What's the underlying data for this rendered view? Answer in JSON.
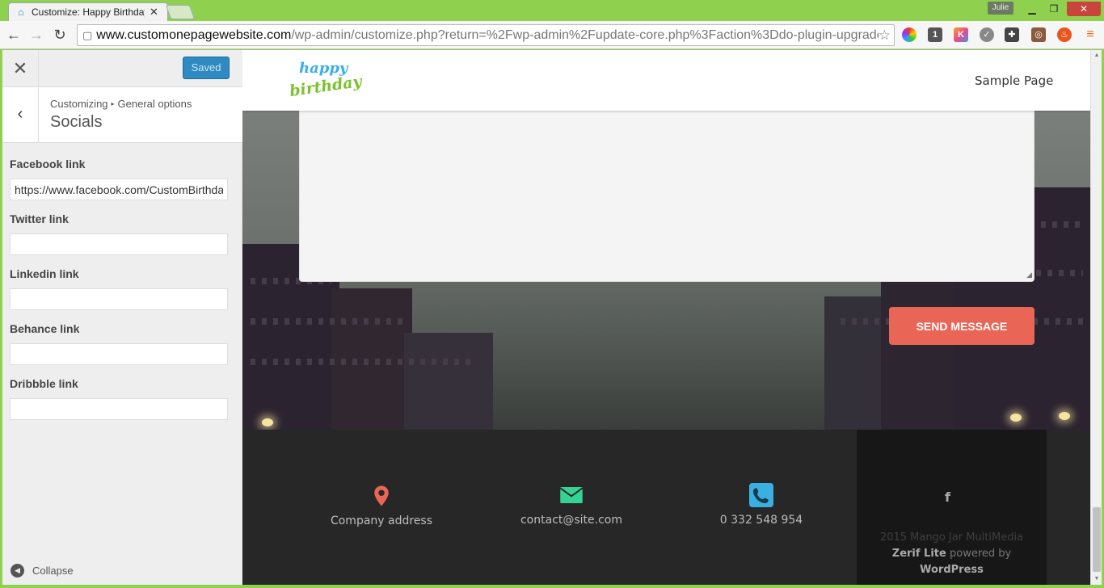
{
  "browser": {
    "tab_title": "Customize: Happy Birthday",
    "tab_close": "✕",
    "profile": "Julie",
    "url_host": "www.customonepagewebsite.com",
    "url_path": "/wp-admin/customize.php?return=%2Fwp-admin%2Fupdate-core.php%3Faction%3Ddo-plugin-upgrade",
    "extensions": [
      "color-wheel-icon",
      "lastpass-icon",
      "k-icon",
      "check-icon",
      "puzzle-icon",
      "instagram-icon",
      "fire-icon",
      "menu-icon"
    ]
  },
  "customizer": {
    "close_label": "✕",
    "saved_label": "Saved",
    "back_label": "‹",
    "breadcrumb_root": "Customizing",
    "breadcrumb_sep": "▸",
    "breadcrumb_section": "General options",
    "section_title": "Socials",
    "fields": [
      {
        "label": "Facebook link",
        "value": "https://www.facebook.com/CustomBirthday"
      },
      {
        "label": "Twitter link",
        "value": ""
      },
      {
        "label": "Linkedin link",
        "value": ""
      },
      {
        "label": "Behance link",
        "value": ""
      },
      {
        "label": "Dribbble link",
        "value": ""
      }
    ],
    "collapse_label": "Collapse"
  },
  "site": {
    "logo_line1": "happy",
    "logo_line2": "birthday",
    "nav_item": "Sample Page",
    "send_label": "SEND MESSAGE",
    "footer": {
      "address": "Company address",
      "email": "contact@site.com",
      "phone": "0 332 548 954",
      "social_icon": "f",
      "copyright": "2015 Mango Jar MultiMedia",
      "theme_name": "Zerif Lite",
      "powered_by": "powered by",
      "platform": "WordPress"
    },
    "colors": {
      "accent": "#e96656",
      "saved": "#2e8ac0",
      "map_pin": "#e96656",
      "mail": "#34d293",
      "phone": "#3ab0e2"
    }
  }
}
